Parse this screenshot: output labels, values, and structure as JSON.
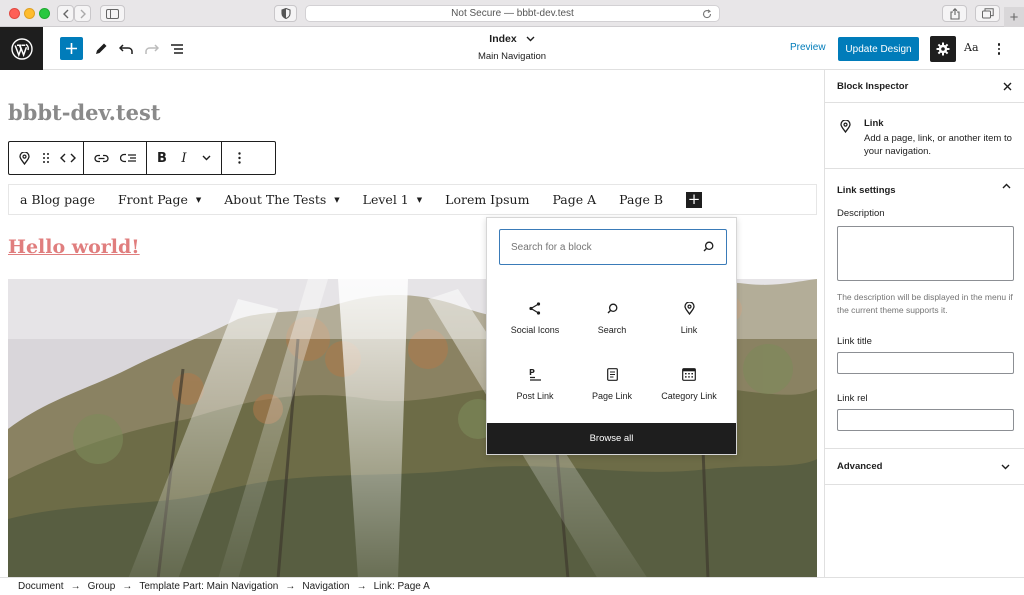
{
  "browser": {
    "url_text": "Not Secure — bbbt-dev.test"
  },
  "toolbar": {
    "doc_title": "Index",
    "doc_subtitle": "Main Navigation",
    "preview_label": "Preview",
    "update_label": "Update Design",
    "styles_label": "Aa"
  },
  "canvas": {
    "site_title": "bbbt-dev.test",
    "nav_items": [
      {
        "label": "a Blog page",
        "has_submenu": false
      },
      {
        "label": "Front Page",
        "has_submenu": true
      },
      {
        "label": "About The Tests",
        "has_submenu": true
      },
      {
        "label": "Level 1",
        "has_submenu": true
      },
      {
        "label": "Lorem Ipsum",
        "has_submenu": false
      },
      {
        "label": "Page A",
        "has_submenu": false
      },
      {
        "label": "Page B",
        "has_submenu": false
      }
    ],
    "post_title": "Hello world!"
  },
  "inserter": {
    "search_placeholder": "Search for a block",
    "blocks": [
      {
        "label": "Social Icons",
        "icon": "share-icon"
      },
      {
        "label": "Search",
        "icon": "search-icon"
      },
      {
        "label": "Link",
        "icon": "map-pin-icon"
      },
      {
        "label": "Post Link",
        "icon": "post-link-icon"
      },
      {
        "label": "Page Link",
        "icon": "page-icon"
      },
      {
        "label": "Category Link",
        "icon": "calendar-icon"
      }
    ],
    "browse_all_label": "Browse all"
  },
  "inspector": {
    "title": "Block Inspector",
    "block_name": "Link",
    "block_description": "Add a page, link, or another item to your navigation.",
    "settings_title": "Link settings",
    "description_label": "Description",
    "description_help": "The description will be displayed in the menu if the current theme supports it.",
    "link_title_label": "Link title",
    "link_rel_label": "Link rel",
    "advanced_title": "Advanced"
  },
  "breadcrumb": [
    "Document",
    "Group",
    "Template Part: Main Navigation",
    "Navigation",
    "Link: Page A"
  ],
  "colors": {
    "accent": "#007cba",
    "dark": "#1e1e1e",
    "link_pink": "#e07e7e",
    "search_border": "#3a7bb8"
  }
}
